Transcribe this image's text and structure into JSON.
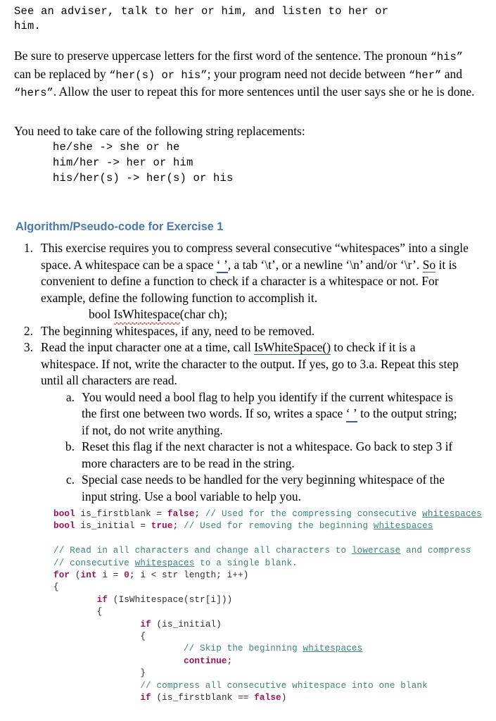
{
  "document": {
    "intro_mono_line1": "See an adviser, talk to her or him, and listen to her or",
    "intro_mono_line2": "him.",
    "paragraph2": {
      "seg1": "Be sure to preserve uppercase letters for the first word of the sentence. The pronoun ",
      "q_his": "“his”",
      "seg2": " can be replaced by ",
      "q_hers_or_his": "“her(s) or his”",
      "seg3": "; your program need not decide between ",
      "q_her": "“her”",
      "seg4": " and ",
      "q_hers": "“hers”",
      "seg5": ". Allow the user to repeat this for more sentences until the user says she or he is done."
    },
    "replacements_lead": "You need to take care of the following string replacements:",
    "replacements": [
      "he/she -> she or he",
      "him/her -> her or him",
      "his/her(s) -> her(s) or his"
    ],
    "algo_heading": "Algorithm/Pseudo-code for Exercise 1",
    "steps": [
      {
        "marker": "1.",
        "level": 1,
        "parts": [
          {
            "text": "This exercise requires you to compress several consecutive “whitespaces” into a single space. A whitespace can be a space "
          },
          {
            "text": "‘ ’",
            "style": "qspace"
          },
          {
            "text": ", a tab ‘\\t’, or a newline ‘\\n’ and/or ‘\\r’. "
          },
          {
            "text": "So",
            "style": "grammar"
          },
          {
            "text": " it is convenient to define a function to check if a character is a whitespace or not. For example, define the following function to accomplish it."
          }
        ]
      },
      {
        "marker": "2.",
        "level": 1,
        "parts": [
          {
            "text": "The beginning whitespaces, if any, need to be removed."
          }
        ]
      },
      {
        "marker": "3.",
        "level": 1,
        "parts": [
          {
            "text": "Read the input character one at a time, call "
          },
          {
            "text": "IsWhiteSpace()",
            "style": "grammar"
          },
          {
            "text": " to check if it is a whitespace. If not, write the character to the output. If yes, go to 3.a. Repeat this step until all characters are read."
          }
        ]
      },
      {
        "marker": "a.",
        "level": 2,
        "parts": [
          {
            "text": "You would need a bool flag to help you identify if the current whitespace is the first one between two words. If so, writes a space "
          },
          {
            "text": "‘ ’",
            "style": "qspace"
          },
          {
            "text": " to the output string; if not, do not write anything."
          }
        ]
      },
      {
        "marker": "b.",
        "level": 2,
        "parts": [
          {
            "text": "Reset this flag if the next character is not a whitespace. Go back to step 3 if more characters are to be read in the string."
          }
        ]
      },
      {
        "marker": "c.",
        "level": 2,
        "parts": [
          {
            "text": "Special case needs to be handled for the very beginning whitespace of the input string. Use a bool variable to help you."
          }
        ]
      }
    ],
    "function_signature": {
      "pre": "bool ",
      "name": "IsWhitespace",
      "post": "(char ch);"
    },
    "code": {
      "colors": {
        "keyword": "#9c1158",
        "comment": "#37857b",
        "identifier": "#2b2b2b",
        "heading_blue": "#4a7ab5",
        "spell_error": "#d2232a",
        "grammar_mark": "#2f5fa8"
      },
      "lines": [
        [
          {
            "t": "bool",
            "c": "kw"
          },
          {
            "t": " is_firstblank = ",
            "c": "id"
          },
          {
            "t": "false",
            "c": "kw"
          },
          {
            "t": ";",
            "c": "pun"
          },
          {
            "t": " // Used for the compressing consecutive ",
            "c": "cmt"
          },
          {
            "t": "whitespaces",
            "c": "cmt-u"
          }
        ],
        [
          {
            "t": "bool",
            "c": "kw"
          },
          {
            "t": " is_initial = ",
            "c": "id"
          },
          {
            "t": "true",
            "c": "kw"
          },
          {
            "t": ";",
            "c": "pun"
          },
          {
            "t": " // Used for removing the beginning ",
            "c": "cmt"
          },
          {
            "t": "whitespaces",
            "c": "cmt-u"
          }
        ],
        [],
        [
          {
            "t": "// Read in all characters and change all characters to ",
            "c": "cmt"
          },
          {
            "t": "lowercase",
            "c": "cmt-u"
          },
          {
            "t": " and compress",
            "c": "cmt"
          }
        ],
        [
          {
            "t": "// consecutive ",
            "c": "cmt"
          },
          {
            "t": "whitespaces",
            "c": "cmt-u"
          },
          {
            "t": " to a single blank.",
            "c": "cmt"
          }
        ],
        [
          {
            "t": "for",
            "c": "kw"
          },
          {
            "t": " (",
            "c": "pun"
          },
          {
            "t": "int",
            "c": "kw"
          },
          {
            "t": " i = ",
            "c": "id"
          },
          {
            "t": "0",
            "c": "num"
          },
          {
            "t": "; i < str length; i++)",
            "c": "id"
          }
        ],
        [
          {
            "t": "{",
            "c": "pun"
          }
        ],
        [
          {
            "t": "        ",
            "c": "id"
          },
          {
            "t": "if",
            "c": "kw"
          },
          {
            "t": " (IsWhitespace(str[i]))",
            "c": "id"
          }
        ],
        [
          {
            "t": "        {",
            "c": "pun"
          }
        ],
        [
          {
            "t": "                ",
            "c": "id"
          },
          {
            "t": "if",
            "c": "kw"
          },
          {
            "t": " (is_initial)",
            "c": "id"
          }
        ],
        [
          {
            "t": "                {",
            "c": "pun"
          }
        ],
        [
          {
            "t": "                        // Skip the beginning ",
            "c": "cmt"
          },
          {
            "t": "whitespaces",
            "c": "cmt-u"
          }
        ],
        [
          {
            "t": "                        ",
            "c": "id"
          },
          {
            "t": "continue",
            "c": "kw"
          },
          {
            "t": ";",
            "c": "pun"
          }
        ],
        [
          {
            "t": "                }",
            "c": "pun"
          }
        ],
        [
          {
            "t": "                // compress all consecutive whitespace into one blank",
            "c": "cmt"
          }
        ],
        [
          {
            "t": "                ",
            "c": "id"
          },
          {
            "t": "if",
            "c": "kw"
          },
          {
            "t": " (is_firstblank == ",
            "c": "id"
          },
          {
            "t": "false",
            "c": "kw"
          },
          {
            "t": ")",
            "c": "pun"
          }
        ]
      ]
    }
  }
}
